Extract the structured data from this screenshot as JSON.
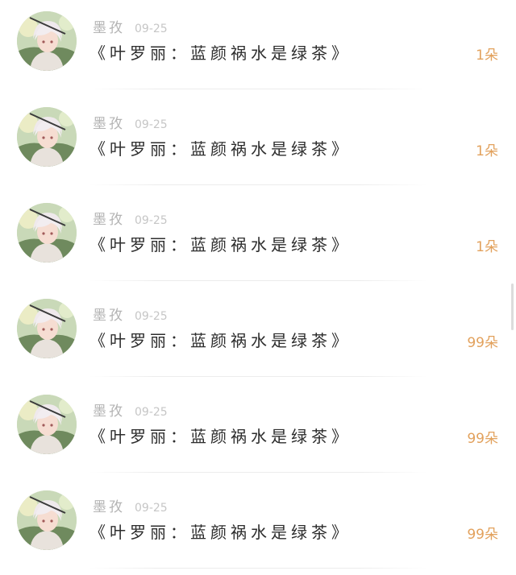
{
  "comments": [
    {
      "author": "墨孜",
      "date": "09-25",
      "text": "《叶罗丽：蓝颜祸水是绿茶》",
      "gift": "1朵"
    },
    {
      "author": "墨孜",
      "date": "09-25",
      "text": "《叶罗丽：蓝颜祸水是绿茶》",
      "gift": "1朵"
    },
    {
      "author": "墨孜",
      "date": "09-25",
      "text": "《叶罗丽：蓝颜祸水是绿茶》",
      "gift": "1朵"
    },
    {
      "author": "墨孜",
      "date": "09-25",
      "text": "《叶罗丽：蓝颜祸水是绿茶》",
      "gift": "99朵"
    },
    {
      "author": "墨孜",
      "date": "09-25",
      "text": "《叶罗丽：蓝颜祸水是绿茶》",
      "gift": "99朵"
    },
    {
      "author": "墨孜",
      "date": "09-25",
      "text": "《叶罗丽：蓝颜祸水是绿茶》",
      "gift": "99朵"
    }
  ],
  "colors": {
    "gift_accent": "#e2a15c",
    "author_text": "#b4b4b4",
    "title_text": "#2d2d2d"
  },
  "icons": {
    "avatar": "anime-avatar-image"
  }
}
